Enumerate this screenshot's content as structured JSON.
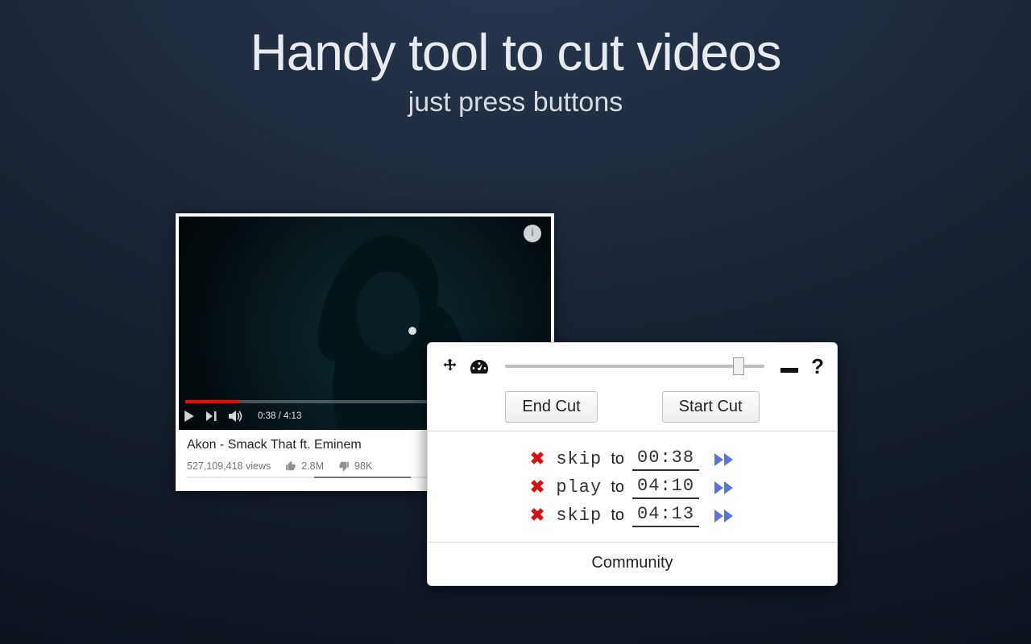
{
  "headline": "Handy tool to cut videos",
  "subhead": "just press buttons",
  "video": {
    "info_icon": "i",
    "time_display": "0:38 / 4:13",
    "title": "Akon - Smack That ft. Eminem",
    "views": "527,109,418 views",
    "likes": "2.8M",
    "dislikes": "98K"
  },
  "panel": {
    "end_cut": "End Cut",
    "start_cut": "Start Cut",
    "to_word": "to",
    "rows": [
      {
        "action": "skip",
        "time": "00:38"
      },
      {
        "action": "play",
        "time": "04:10"
      },
      {
        "action": "skip",
        "time": "04:13"
      }
    ],
    "community": "Community"
  }
}
